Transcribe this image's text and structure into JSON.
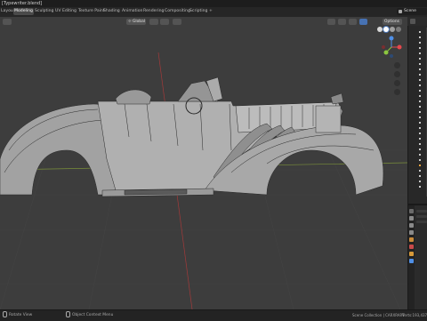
{
  "window": {
    "title": "[Typewriter.blend]"
  },
  "workspace_tabs": [
    {
      "label": "Layout",
      "active": false
    },
    {
      "label": "Modeling",
      "active": true
    },
    {
      "label": "Sculpting",
      "active": false
    },
    {
      "label": "UV Editing",
      "active": false
    },
    {
      "label": "Texture Paint",
      "active": false
    },
    {
      "label": "Shading",
      "active": false
    },
    {
      "label": "Animation",
      "active": false
    },
    {
      "label": "Rendering",
      "active": false
    },
    {
      "label": "Compositing",
      "active": false
    },
    {
      "label": "Scripting",
      "active": false
    }
  ],
  "add_workspace_label": "+",
  "scene": {
    "label": "Scene"
  },
  "viewport_header": {
    "transform_orientation": "Global",
    "options_label": "Options"
  },
  "status": {
    "left_hint": "Rotate View",
    "middle_hint": "Object Context Menu",
    "collection": "Scene Collection | CARXRART",
    "stats": "Verts:193,437 | Faces"
  },
  "colors": {
    "accent": "#4772b3",
    "active_orange": "#e8a33d",
    "axis_x": "#e5484d",
    "axis_y": "#8cc63f",
    "axis_z": "#4f8fe6"
  }
}
